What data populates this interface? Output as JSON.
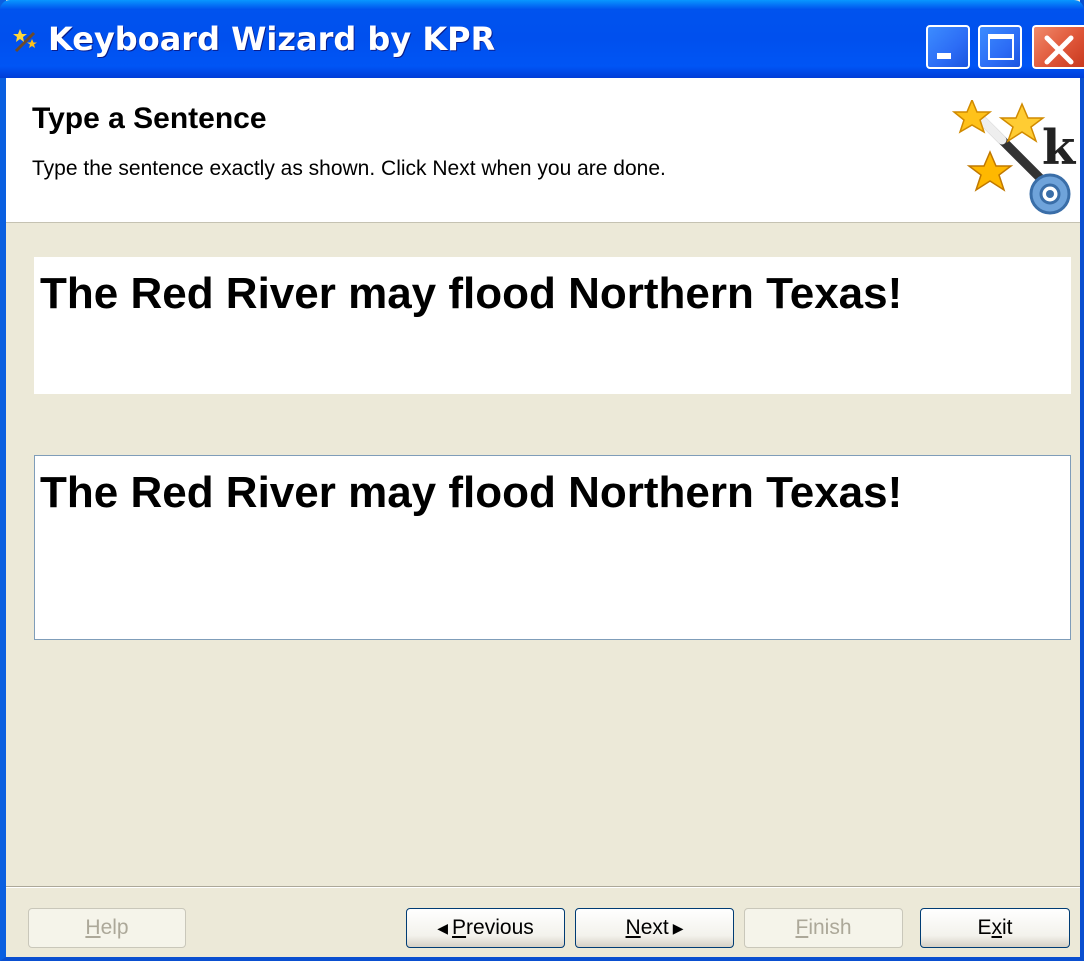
{
  "window": {
    "title": "Keyboard Wizard by KPR"
  },
  "header": {
    "title": "Type a Sentence",
    "subtitle": "Type the sentence exactly as shown. Click Next when you are done."
  },
  "content": {
    "target_sentence": "The Red River may flood Northern Texas!",
    "typed_value": "The Red River may flood Northern Texas!"
  },
  "buttons": {
    "help": {
      "mnemonic": "H",
      "rest": "elp",
      "enabled": false
    },
    "previous": {
      "mnemonic": "P",
      "rest": "revious",
      "enabled": true
    },
    "next": {
      "mnemonic": "N",
      "rest": "ext",
      "enabled": true
    },
    "finish": {
      "mnemonic": "F",
      "rest": "inish",
      "enabled": false
    },
    "exit": {
      "pre": "E",
      "mnemonic": "x",
      "rest": "it",
      "enabled": true
    }
  },
  "icons": {
    "app": "app-wizard-icon",
    "logo": "wizard-wand-stars-k-gear-logo",
    "minimize": "minimize-icon",
    "maximize": "maximize-icon",
    "close": "close-icon"
  },
  "colors": {
    "titlebar": "#0053EE",
    "close_button": "#E0573A",
    "face": "#ECE9D8",
    "text_border": "#7F9DB9"
  }
}
